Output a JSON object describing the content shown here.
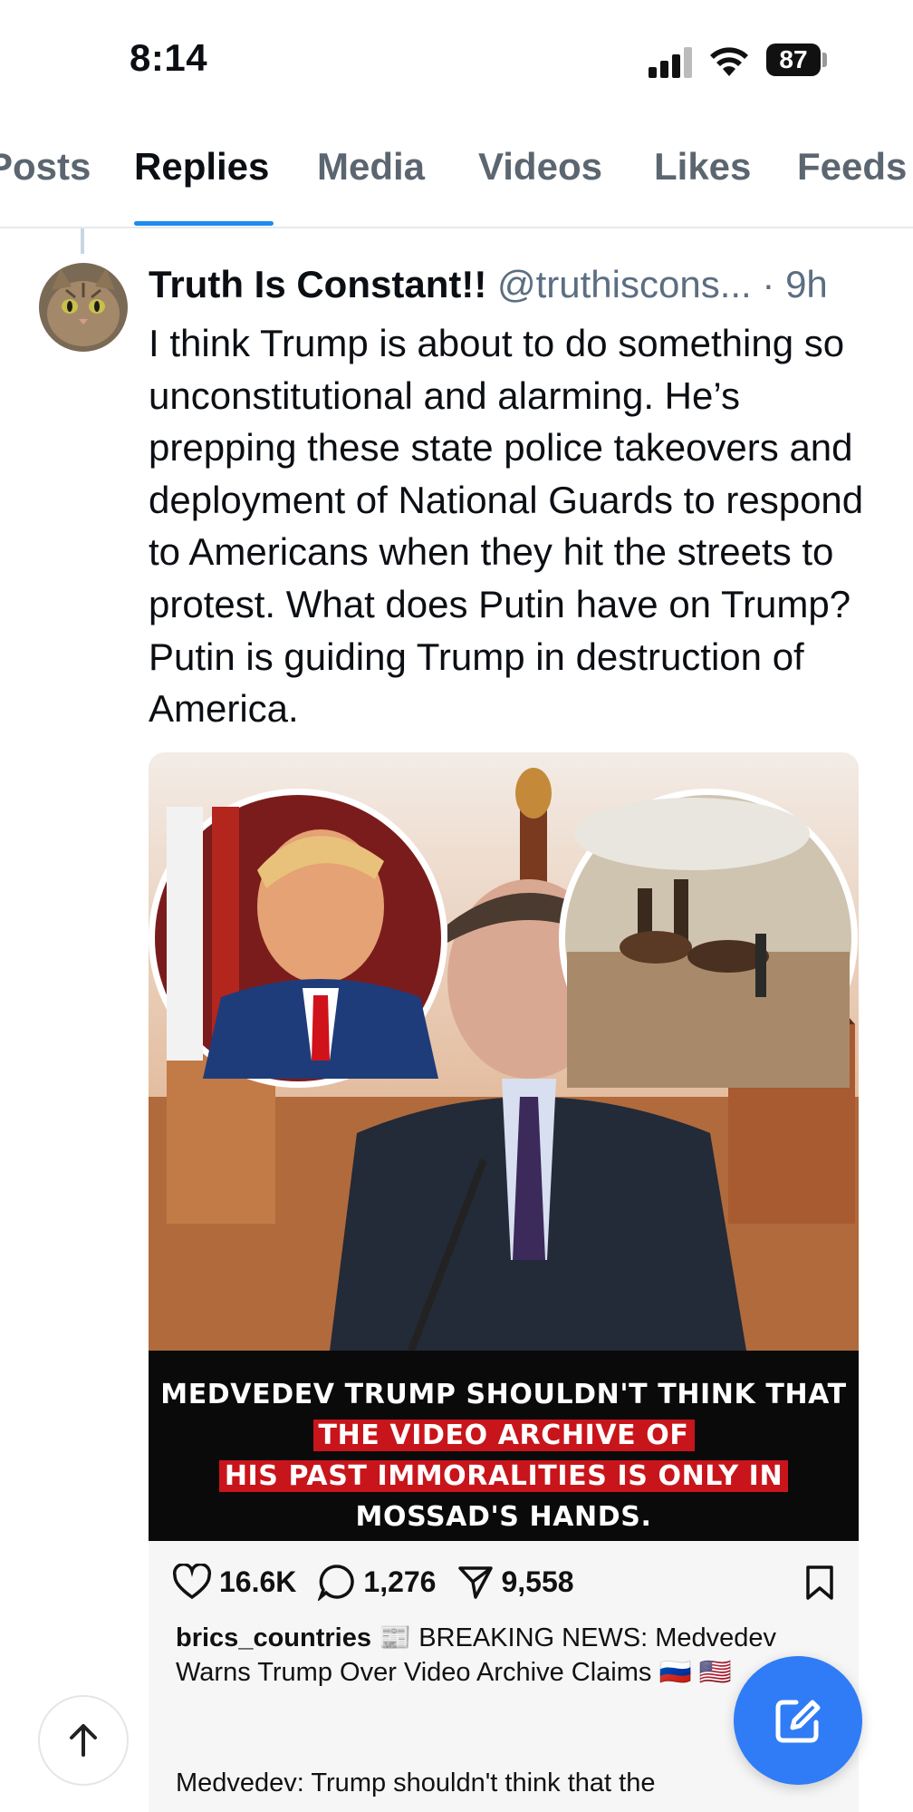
{
  "status_bar": {
    "time": "8:14",
    "battery": "87"
  },
  "tabs": [
    {
      "label": "Posts"
    },
    {
      "label": "Replies"
    },
    {
      "label": "Media"
    },
    {
      "label": "Videos"
    },
    {
      "label": "Likes"
    },
    {
      "label": "Feeds"
    }
  ],
  "active_tab": "Replies",
  "post": {
    "author": "Truth Is Constant!!",
    "handle": "@truthiscons...",
    "separator": "·",
    "age": "9h",
    "text": "I think Trump is about to do something so unconstitutional and alarming. He’s prepping these state police takeovers and deployment of National Guards to respond to Americans when they hit the streets to protest. What does Putin have on Trump? Putin is guiding Trump in destruction of America.",
    "image": {
      "caption_part1": "MEDVEDEV TRUMP SHOULDN'T THINK THAT",
      "caption_part2": "THE VIDEO ARCHIVE OF",
      "caption_part3": "HIS PAST IMMORALITIES IS ONLY IN",
      "caption_part4": "MOSSAD'S HANDS."
    },
    "embed": {
      "likes": "16.6K",
      "comments": "1,276",
      "shares": "9,558",
      "account": "brics_countries",
      "headline": "📰 BREAKING NEWS: Medvedev Warns Trump Over Video Archive Claims 🇷🇺 🇺🇸",
      "body": "Medvedev: Trump shouldn't think that the"
    }
  },
  "colors": {
    "accent": "#1d8cf0",
    "fab": "#2f7cf6",
    "caption_highlight": "#c8151b"
  }
}
